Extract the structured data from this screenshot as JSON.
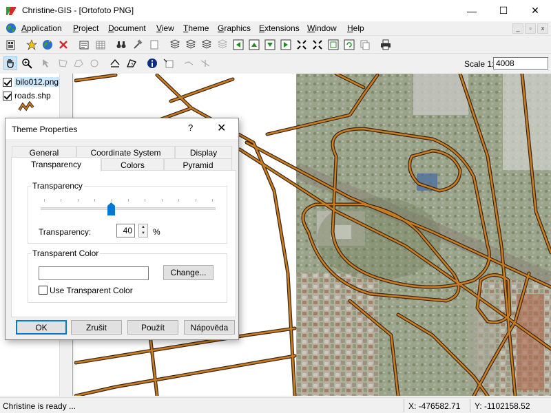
{
  "window": {
    "title": "Christine-GIS - [Ortofoto PNG]",
    "minimize": "—",
    "maximize": "☐",
    "close": "✕"
  },
  "menu": {
    "items": [
      {
        "first": "A",
        "rest": "pplication"
      },
      {
        "first": "P",
        "rest": "roject"
      },
      {
        "first": "D",
        "rest": "ocument"
      },
      {
        "first": "V",
        "rest": "iew"
      },
      {
        "first": "T",
        "rest": "heme"
      },
      {
        "first": "G",
        "rest": "raphics"
      },
      {
        "first": "E",
        "rest": "xtensions"
      },
      {
        "first": "W",
        "rest": "indow"
      },
      {
        "first": "H",
        "rest": "elp"
      }
    ],
    "mdi_min": "_",
    "mdi_restore": "▫",
    "mdi_close": "x"
  },
  "scale": {
    "label": "Scale 1:",
    "value": "4008"
  },
  "layers": [
    {
      "name": "bilo012.png",
      "checked": true,
      "selected": true
    },
    {
      "name": "roads.shp",
      "checked": true,
      "selected": false
    }
  ],
  "status": {
    "message": "Christine is ready ...",
    "x": "X:  -476582.71",
    "y": "Y:  -1102158.52"
  },
  "dialog": {
    "title": "Theme Properties",
    "help": "?",
    "close": "✕",
    "tabs_row1": [
      "General",
      "Coordinate System",
      "Display"
    ],
    "tabs_row2": [
      "Transparency",
      "Colors",
      "Pyramid"
    ],
    "transparency_group": "Transparency",
    "transparency_label": "Transparency:",
    "transparency_value": "40",
    "transparency_fraction": 0.4,
    "percent": "%",
    "color_group": "Transparent Color",
    "color_value": "",
    "change_button": "Change...",
    "use_transparent_label": "Use Transparent Color",
    "use_transparent_checked": false,
    "buttons": [
      "OK",
      "Zrušit",
      "Použít",
      "Nápověda"
    ]
  },
  "colors": {
    "road": "#c87d22",
    "road_outline": "#3a2410",
    "accent": "#0078d7"
  }
}
